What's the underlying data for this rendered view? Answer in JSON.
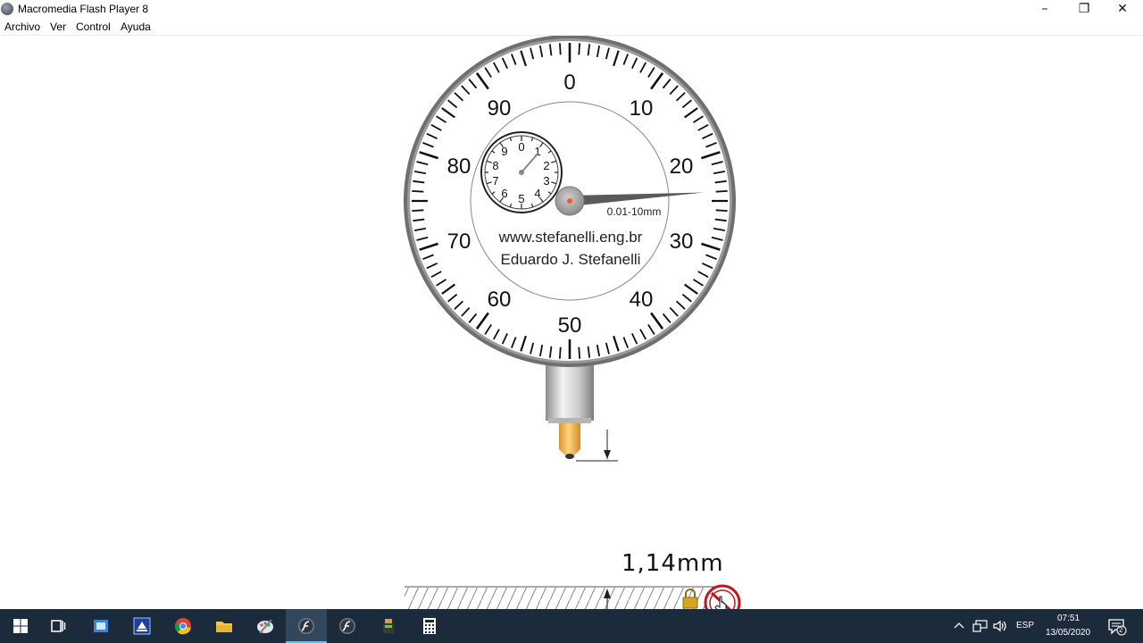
{
  "window": {
    "title": "Macromedia Flash Player 8",
    "controls": {
      "minimize": "–",
      "restore": "❐",
      "close": "✕"
    }
  },
  "menu": [
    "Archivo",
    "Ver",
    "Control",
    "Ayuda"
  ],
  "dial": {
    "major_labels": [
      "0",
      "10",
      "20",
      "30",
      "40",
      "50",
      "60",
      "70",
      "80",
      "90"
    ],
    "small_dial_labels": [
      "0",
      "1",
      "2",
      "3",
      "4",
      "5",
      "6",
      "7",
      "8",
      "9"
    ],
    "range_label": "0.01-10mm",
    "website": "www.stefanelli.eng.br",
    "author": "Eduardo J. Stefanelli",
    "needle_reading": 14,
    "small_needle_reading": 1.14
  },
  "measurement": {
    "value": "1,14mm"
  },
  "colors": {
    "taskbar_bg": "#1c2b3c",
    "dial_ring": "#7a7a7a",
    "needle": "#555555",
    "tip": "#f2b24c",
    "center_dot": "#f05a28"
  },
  "taskbar": {
    "icons": [
      "windows-start-icon",
      "task-view-icon",
      "outlook-icon",
      "scanner-icon",
      "chrome-icon",
      "file-explorer-icon",
      "paint-icon",
      "flash-player-icon",
      "flash-player-icon-2",
      "tools-icon",
      "calculator-icon"
    ],
    "tray": {
      "language": "ESP",
      "time": "07:51",
      "date": "13/05/2020",
      "notifications": "2"
    }
  }
}
